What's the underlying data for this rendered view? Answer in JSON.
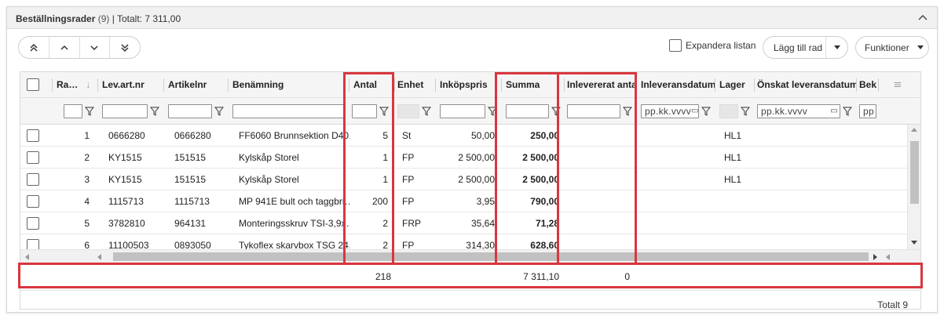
{
  "panel": {
    "title": "Beställningsrader",
    "count": "(9)",
    "total_label": "| Totalt: 7 311,00"
  },
  "toolbar": {
    "expand_label": "Expandera listan",
    "add_row_label": "Lägg till rad",
    "functions_label": "Funktioner"
  },
  "columns": {
    "row": "Ra…",
    "lev_art": "Lev.art.nr",
    "artikel": "Artikelnr",
    "benamning": "Benämning",
    "antal": "Antal",
    "enhet": "Enhet",
    "inkopspris": "Inköpspris",
    "summa": "Summa",
    "inlevererat": "Inlevererat antal",
    "inleveransdatum": "Inleveransdatum",
    "lager": "Lager",
    "onskat": "Önskat leveransdatum",
    "bek": "Bek"
  },
  "filters": {
    "date_placeholder_1": "pp.kk.vvvv",
    "date_placeholder_2": "pp.kk.vvvv",
    "date_placeholder_3": "pp"
  },
  "rows": [
    {
      "nr": "1",
      "lev": "0666280",
      "art": "0666280",
      "ben": "FF6060 Brunnsektion D40…",
      "antal": "5",
      "enhet": "St",
      "pris": "50,00",
      "summa": "250,00",
      "lager": "HL1"
    },
    {
      "nr": "2",
      "lev": "KY1515",
      "art": "151515",
      "ben": "Kylskåp Storel",
      "antal": "1",
      "enhet": "FP",
      "pris": "2 500,00",
      "summa": "2 500,00",
      "lager": "HL1"
    },
    {
      "nr": "3",
      "lev": "KY1515",
      "art": "151515",
      "ben": "Kylskåp Storel",
      "antal": "1",
      "enhet": "FP",
      "pris": "2 500,00",
      "summa": "2 500,00",
      "lager": "HL1"
    },
    {
      "nr": "4",
      "lev": "1115713",
      "art": "1115713",
      "ben": "MP 941E bult och taggbri…",
      "antal": "200",
      "enhet": "FP",
      "pris": "3,95",
      "summa": "790,00",
      "lager": ""
    },
    {
      "nr": "5",
      "lev": "3782810",
      "art": "964131",
      "ben": "Monteringsskruv TSI-3,9x…",
      "antal": "2",
      "enhet": "FRP",
      "pris": "35,64",
      "summa": "71,28",
      "lager": ""
    },
    {
      "nr": "6",
      "lev": "11100503",
      "art": "0893050",
      "ben": "Tykoflex skarvbox TSG 24…",
      "antal": "2",
      "enhet": "FP",
      "pris": "314,30",
      "summa": "628,60",
      "lager": ""
    }
  ],
  "totals": {
    "antal": "218",
    "summa": "7 311,10",
    "inlevererat": "0"
  },
  "footer": {
    "count_label": "Totalt 9"
  },
  "colors": {
    "highlight": "#d9363e"
  }
}
